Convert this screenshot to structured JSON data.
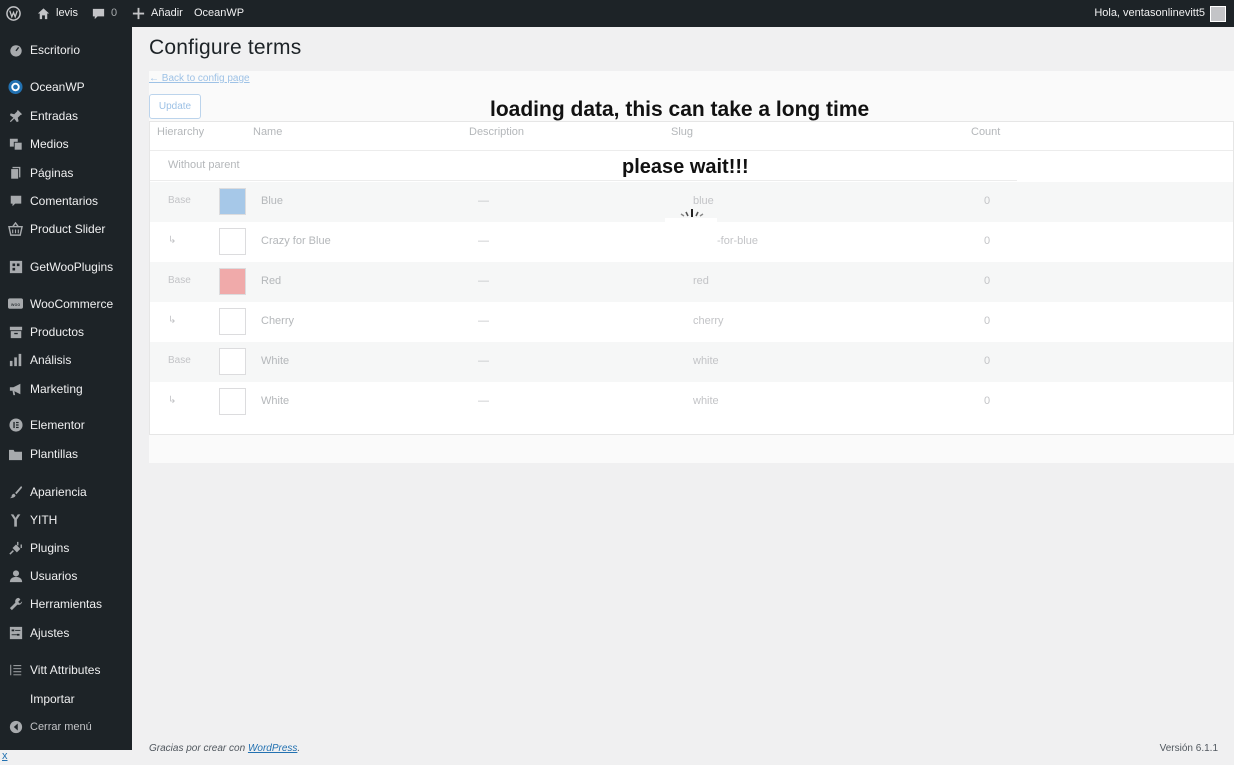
{
  "admin_bar": {
    "site_name": "levis",
    "comment_count": "0",
    "new_label": "Añadir",
    "theme_link": "OceanWP",
    "account_greeting": "Hola, ventasonlinevitt5"
  },
  "sidebar": {
    "items": [
      {
        "label": "Escritorio",
        "icon": "dashboard-icon"
      },
      {
        "label": "OceanWP",
        "icon": "oceanwp-icon"
      },
      {
        "label": "Entradas",
        "icon": "pin-icon"
      },
      {
        "label": "Medios",
        "icon": "media-icon"
      },
      {
        "label": "Páginas",
        "icon": "pages-icon"
      },
      {
        "label": "Comentarios",
        "icon": "comment-icon"
      },
      {
        "label": "Product Slider",
        "icon": "basket-icon"
      },
      {
        "label": "GetWooPlugins",
        "icon": "plugin-box-icon"
      },
      {
        "label": "WooCommerce",
        "icon": "woo-icon"
      },
      {
        "label": "Productos",
        "icon": "archive-icon"
      },
      {
        "label": "Análisis",
        "icon": "chart-bar-icon"
      },
      {
        "label": "Marketing",
        "icon": "megaphone-icon"
      },
      {
        "label": "Elementor",
        "icon": "elementor-icon"
      },
      {
        "label": "Plantillas",
        "icon": "folder-icon"
      },
      {
        "label": "Apariencia",
        "icon": "brush-icon"
      },
      {
        "label": "YITH",
        "icon": "yith-icon"
      },
      {
        "label": "Plugins",
        "icon": "plug-icon"
      },
      {
        "label": "Usuarios",
        "icon": "users-icon"
      },
      {
        "label": "Herramientas",
        "icon": "wrench-icon"
      },
      {
        "label": "Ajustes",
        "icon": "settings-icon"
      },
      {
        "label": "Vitt Attributes",
        "icon": "list-icon"
      },
      {
        "label": "Importar",
        "icon": ""
      },
      {
        "label": "Cerrar menú",
        "icon": "collapse-icon"
      }
    ]
  },
  "page": {
    "title": "Configure terms",
    "back_link": "← Back to config page",
    "update_button": "Update",
    "loading_message": "loading data, this can take a long time",
    "wait_message": "please wait!!!"
  },
  "table": {
    "headers": {
      "hierarchy": "Hierarchy",
      "name": "Name",
      "description": "Description",
      "slug": "Slug",
      "count": "Count"
    },
    "group_label": "Without parent",
    "rows": [
      {
        "hierarchy": "Base",
        "color": "#a6c8e8",
        "name": "Blue",
        "description": "—",
        "slug": "blue",
        "count": "0"
      },
      {
        "hierarchy": "↳",
        "color": "#ffffff",
        "name": "Crazy for Blue",
        "description": "—",
        "slug": "-for-blue",
        "count": "0"
      },
      {
        "hierarchy": "Base",
        "color": "#f0aaaa",
        "name": "Red",
        "description": "—",
        "slug": "red",
        "count": "0"
      },
      {
        "hierarchy": "↳",
        "color": "#ffffff",
        "name": "Cherry",
        "description": "—",
        "slug": "cherry",
        "count": "0"
      },
      {
        "hierarchy": "Base",
        "color": "#ffffff",
        "name": "White",
        "description": "—",
        "slug": "white",
        "count": "0"
      },
      {
        "hierarchy": "↳",
        "color": "#ffffff",
        "name": "White",
        "description": "—",
        "slug": "white",
        "count": "0"
      }
    ]
  },
  "footer": {
    "thanks_prefix": "Gracias por crear con ",
    "wordpress_link": "WordPress",
    "thanks_suffix": ".",
    "version": "Versión 6.1.1"
  },
  "corner_link": "x"
}
